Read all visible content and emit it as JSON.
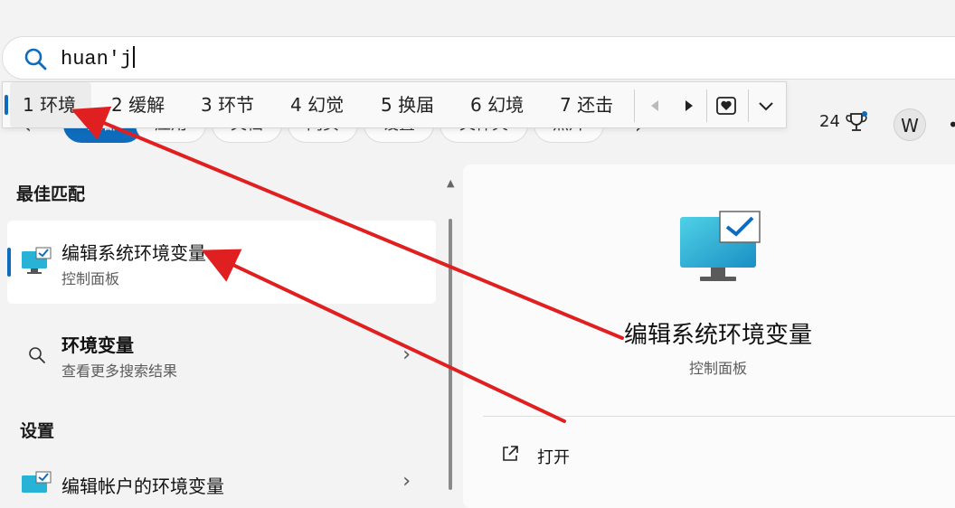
{
  "search": {
    "query": "huan'j"
  },
  "filters": {
    "items": [
      "全部",
      "应用",
      "文档",
      "网页",
      "设置",
      "文件夹",
      "照片"
    ]
  },
  "ime": {
    "candidates": [
      {
        "num": "1",
        "text": "环境"
      },
      {
        "num": "2",
        "text": "缓解"
      },
      {
        "num": "3",
        "text": "环节"
      },
      {
        "num": "4",
        "text": "幻觉"
      },
      {
        "num": "5",
        "text": "换届"
      },
      {
        "num": "6",
        "text": "幻境"
      },
      {
        "num": "7",
        "text": "还击"
      }
    ]
  },
  "header": {
    "points": "24",
    "avatar_initial": "W"
  },
  "results": {
    "best_match_label": "最佳匹配",
    "best_match": {
      "title": "编辑系统环境变量",
      "subtitle": "控制面板"
    },
    "web": {
      "title": "环境变量",
      "subtitle": "查看更多搜索结果"
    },
    "settings_label": "设置",
    "settings_item": {
      "title": "编辑帐户的环境变量"
    }
  },
  "detail": {
    "title": "编辑系统环境变量",
    "subtitle": "控制面板",
    "open_label": "打开"
  },
  "colors": {
    "accent": "#0f6cbd",
    "arrow": "#e02020"
  }
}
